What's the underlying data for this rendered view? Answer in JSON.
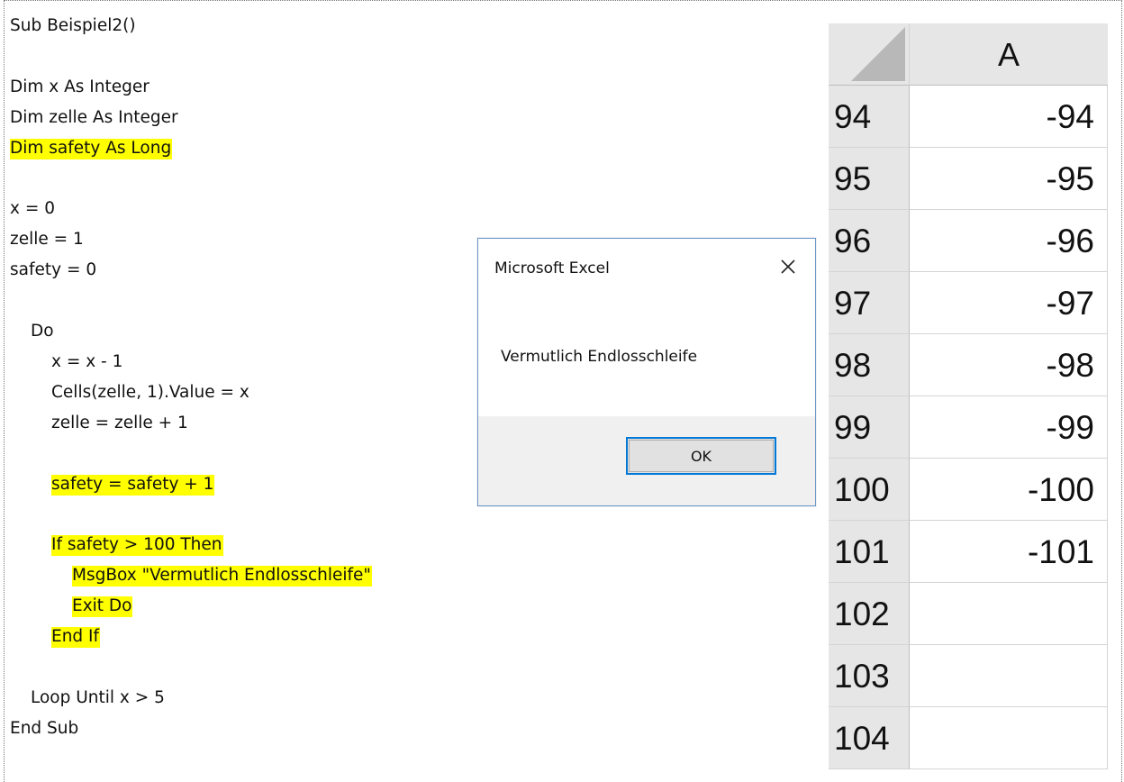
{
  "code": {
    "lines": [
      {
        "text": "Sub Beispiel2()",
        "indent": 0,
        "highlight": false
      },
      {
        "text": "",
        "indent": 0,
        "highlight": false
      },
      {
        "text": "Dim x As Integer",
        "indent": 0,
        "highlight": false
      },
      {
        "text": "Dim zelle As Integer",
        "indent": 0,
        "highlight": false
      },
      {
        "text": "Dim safety As Long",
        "indent": 0,
        "highlight": true
      },
      {
        "text": "",
        "indent": 0,
        "highlight": false
      },
      {
        "text": "x = 0",
        "indent": 0,
        "highlight": false
      },
      {
        "text": "zelle = 1",
        "indent": 0,
        "highlight": false
      },
      {
        "text": "safety = 0",
        "indent": 0,
        "highlight": false
      },
      {
        "text": "",
        "indent": 0,
        "highlight": false
      },
      {
        "text": "Do",
        "indent": 1,
        "highlight": false
      },
      {
        "text": "x = x - 1",
        "indent": 2,
        "highlight": false
      },
      {
        "text": "Cells(zelle, 1).Value = x",
        "indent": 2,
        "highlight": false
      },
      {
        "text": "zelle = zelle + 1",
        "indent": 2,
        "highlight": false
      },
      {
        "text": "",
        "indent": 0,
        "highlight": false
      },
      {
        "text": "safety = safety + 1",
        "indent": 2,
        "highlight": true
      },
      {
        "text": "",
        "indent": 0,
        "highlight": false
      },
      {
        "text": "If safety > 100 Then",
        "indent": 2,
        "highlight": true
      },
      {
        "text": "MsgBox \"Vermutlich Endlosschleife\"",
        "indent": 3,
        "highlight": true
      },
      {
        "text": "Exit Do",
        "indent": 3,
        "highlight": true
      },
      {
        "text": "End If",
        "indent": 2,
        "highlight": true
      },
      {
        "text": "",
        "indent": 0,
        "highlight": false
      },
      {
        "text": "Loop Until x > 5",
        "indent": 1,
        "highlight": false
      },
      {
        "text": "End Sub",
        "indent": 0,
        "highlight": false
      }
    ]
  },
  "dialog": {
    "title": "Microsoft Excel",
    "message": "Vermutlich Endlosschleife",
    "ok_label": "OK",
    "close_icon": "close-icon"
  },
  "sheet": {
    "column_header": "A",
    "rows": [
      {
        "num": "94",
        "value": "-94"
      },
      {
        "num": "95",
        "value": "-95"
      },
      {
        "num": "96",
        "value": "-96"
      },
      {
        "num": "97",
        "value": "-97"
      },
      {
        "num": "98",
        "value": "-98"
      },
      {
        "num": "99",
        "value": "-99"
      },
      {
        "num": "100",
        "value": "-100"
      },
      {
        "num": "101",
        "value": "-101"
      },
      {
        "num": "102",
        "value": ""
      },
      {
        "num": "103",
        "value": ""
      },
      {
        "num": "104",
        "value": ""
      }
    ]
  },
  "colors": {
    "highlight": "#ffff00",
    "dialog_border": "#6d94c9",
    "ok_focus": "#0078d7",
    "header_bg": "#e6e6e6"
  }
}
